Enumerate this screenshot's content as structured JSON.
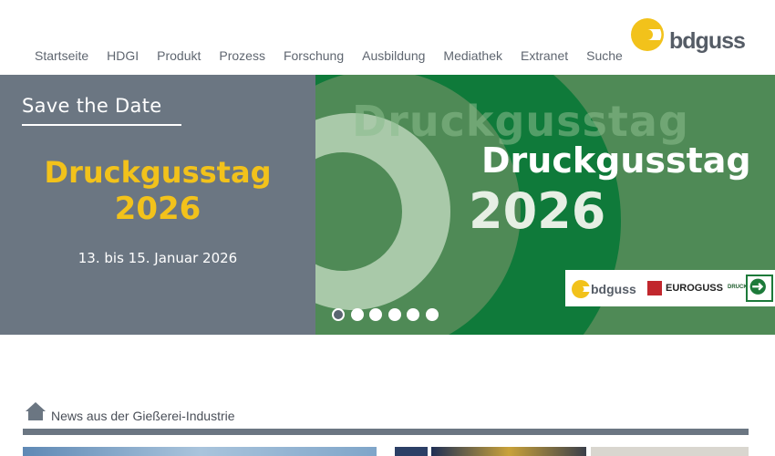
{
  "nav": {
    "items": [
      {
        "label": "Startseite",
        "key": "startseite"
      },
      {
        "label": "HDGI",
        "key": "hdgi"
      },
      {
        "label": "Produkt",
        "key": "produkt"
      },
      {
        "label": "Prozess",
        "key": "prozess"
      },
      {
        "label": "Forschung",
        "key": "forschung"
      },
      {
        "label": "Ausbildung",
        "key": "ausbildung"
      },
      {
        "label": "Mediathek",
        "key": "mediathek"
      },
      {
        "label": "Extranet",
        "key": "extranet"
      },
      {
        "label": "Suche",
        "key": "suche"
      }
    ]
  },
  "logo": {
    "text": "bdguss",
    "icon": "bdguss-logo-icon"
  },
  "hero": {
    "left": {
      "save_the_date": "Save the Date",
      "title_line1": "Druckgusstag",
      "title_line2": "2026",
      "date": "13. bis 15. Januar 2026"
    },
    "right": {
      "ghost_text": "Druckgusstag",
      "title_line1": "Druckgusstag",
      "title_line2": "2026"
    },
    "partners": {
      "bdguss": "bdguss",
      "euroguss": "EUROGUSS",
      "druckguss": "DRUCKGUSS"
    },
    "dots": {
      "count": 6,
      "active_index": 0
    }
  },
  "news": {
    "title": "News aus der Gießerei-Industrie",
    "icon": "home-icon"
  },
  "colors": {
    "accent_yellow": "#f2c21b",
    "slate": "#6b7682",
    "green": "#4f8a56"
  }
}
